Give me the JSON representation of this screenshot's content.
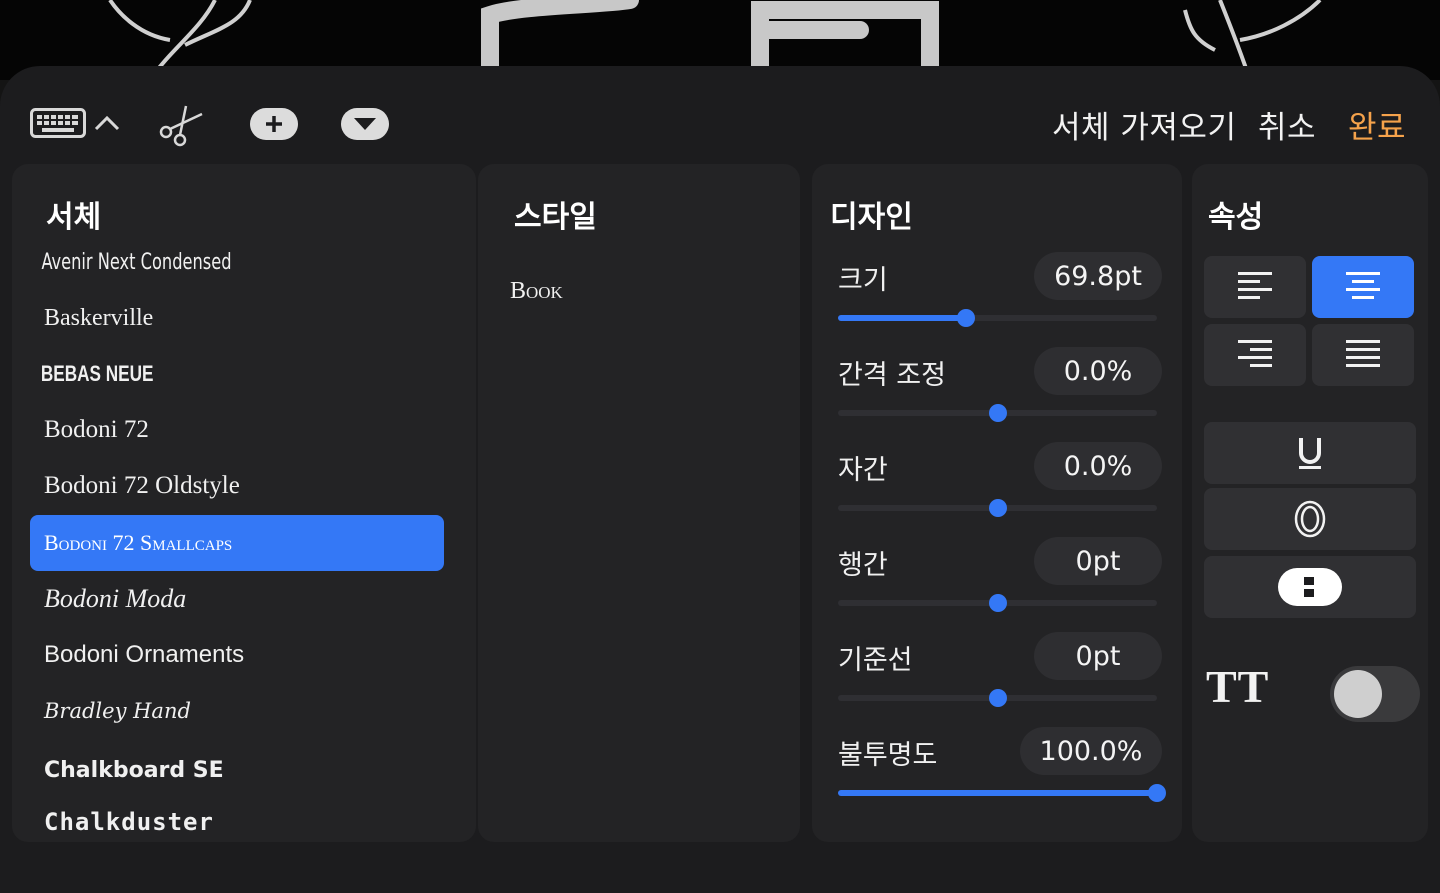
{
  "toolbar": {
    "import_font": "서체 가져오기",
    "cancel": "취소",
    "done": "완료",
    "accent_color": "#f5a24b"
  },
  "panels": {
    "font": {
      "title": "서체",
      "items": [
        "Avenir Next Condensed",
        "Baskerville",
        "BEBAS NEUE",
        "Bodoni 72",
        "Bodoni 72 Oldstyle",
        "Bodoni 72 Smallcaps",
        "Bodoni Moda",
        "Bodoni Ornaments",
        "Bradley Hand",
        "Chalkboard SE",
        "Chalkduster"
      ],
      "selected": "Bodoni 72 Smallcaps"
    },
    "style": {
      "title": "스타일",
      "items": [
        "Book"
      ]
    },
    "design": {
      "title": "디자인",
      "rows": [
        {
          "label": "크기",
          "value": "69.8pt",
          "level": 0.4
        },
        {
          "label": "간격 조정",
          "value": "0.0%",
          "level": 0.5
        },
        {
          "label": "자간",
          "value": "0.0%",
          "level": 0.5
        },
        {
          "label": "행간",
          "value": "0pt",
          "level": 0.5
        },
        {
          "label": "기준선",
          "value": "0pt",
          "level": 0.5
        },
        {
          "label": "불투명도",
          "value": "100.0%",
          "level": 1.0
        }
      ]
    },
    "attributes": {
      "title": "속성",
      "alignment_selected": "center",
      "tt_label": "TT",
      "tt_toggle": "off"
    }
  },
  "colors": {
    "selection_blue": "#3478f6",
    "sheet_bg": "#1c1c1e",
    "panel_bg": "#232325"
  }
}
